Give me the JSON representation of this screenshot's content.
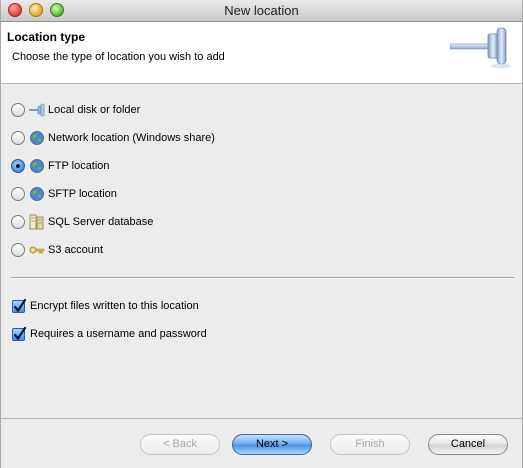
{
  "window": {
    "title": "New location"
  },
  "header": {
    "title": "Location type",
    "subtitle": "Choose the type of location you wish to add",
    "icon": "plug-connector-icon"
  },
  "options": [
    {
      "label": "Local disk or folder",
      "icon": "plug-icon",
      "selected": false
    },
    {
      "label": "Network location (Windows share)",
      "icon": "globe-icon",
      "selected": false
    },
    {
      "label": "FTP location",
      "icon": "globe-icon",
      "selected": true
    },
    {
      "label": "SFTP location",
      "icon": "globe-icon",
      "selected": false
    },
    {
      "label": "SQL Server database",
      "icon": "database-icon",
      "selected": false
    },
    {
      "label": "S3 account",
      "icon": "key-icon",
      "selected": false
    }
  ],
  "checks": [
    {
      "label": "Encrypt files written to this location",
      "checked": true
    },
    {
      "label": "Requires a username and password",
      "checked": true
    }
  ],
  "buttons": {
    "back": "< Back",
    "next": "Next >",
    "finish": "Finish",
    "cancel": "Cancel"
  },
  "colors": {
    "accent": "#4a8ee0",
    "window_bg": "#ececec"
  }
}
